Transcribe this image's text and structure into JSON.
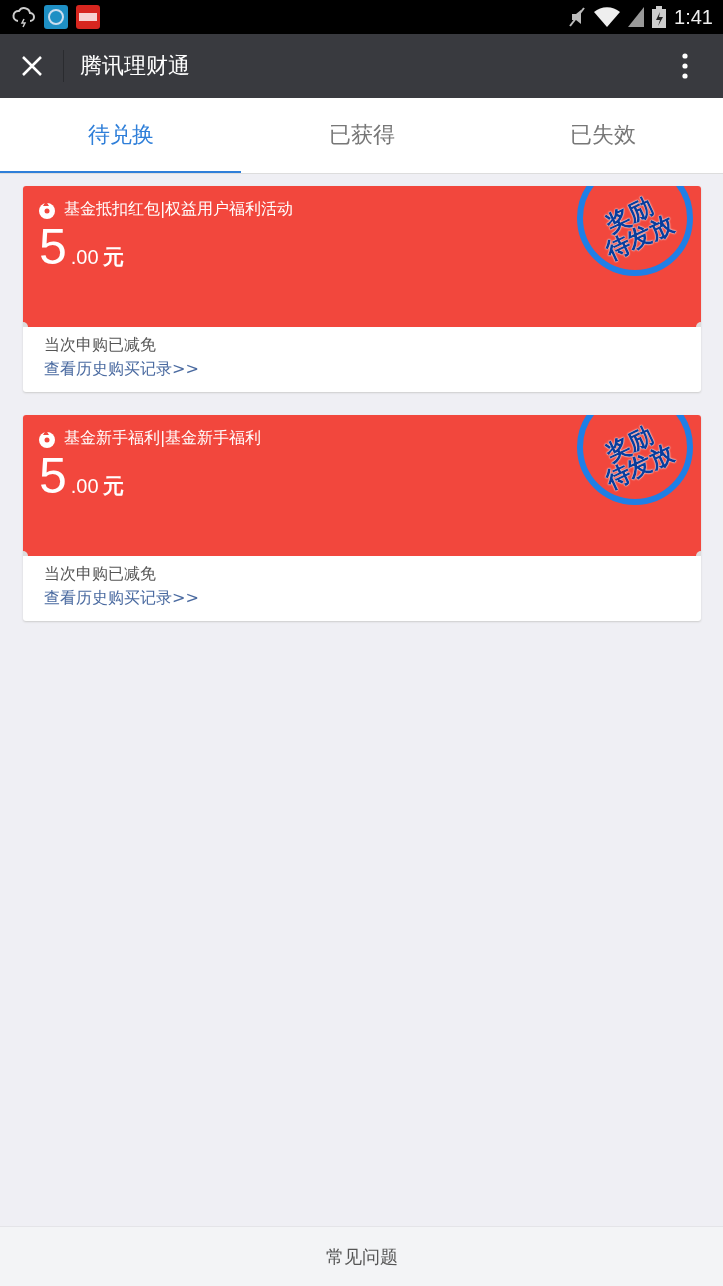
{
  "status_bar": {
    "time": "1:41"
  },
  "header": {
    "title": "腾讯理财通"
  },
  "tabs": [
    {
      "label": "待兑换",
      "selected": true
    },
    {
      "label": "已获得",
      "selected": false
    },
    {
      "label": "已失效",
      "selected": false
    }
  ],
  "coupons": [
    {
      "title": "基金抵扣红包|权益用户福利活动",
      "amount_int": "5",
      "amount_dec": ".00",
      "unit": "元",
      "stamp": [
        "奖励",
        "待发放"
      ],
      "note": "当次申购已减免",
      "link": "查看历史购买记录>>"
    },
    {
      "title": "基金新手福利|基金新手福利",
      "amount_int": "5",
      "amount_dec": ".00",
      "unit": "元",
      "stamp": [
        "奖励",
        "待发放"
      ],
      "note": "当次申购已减免",
      "link": "查看历史购买记录>>"
    }
  ],
  "footer": {
    "label": "常见问题"
  }
}
